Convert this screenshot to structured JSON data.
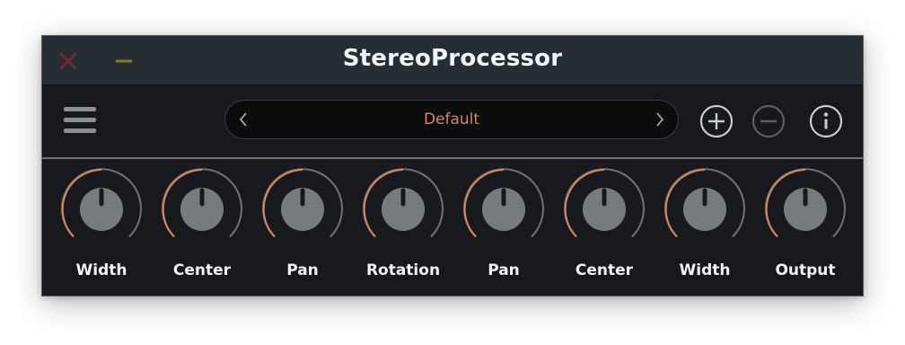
{
  "window": {
    "title": "StereoProcessor"
  },
  "toolbar": {
    "menu_icon": "hamburger-menu-icon",
    "preset": {
      "name": "Default",
      "prev_icon": "chevron-left-icon",
      "next_icon": "chevron-right-icon"
    },
    "add_icon": "plus-circle-icon",
    "remove_icon": "minus-circle-icon",
    "info_icon": "info-circle-icon"
  },
  "knobs": [
    {
      "label": "Width"
    },
    {
      "label": "Center"
    },
    {
      "label": "Pan"
    },
    {
      "label": "Rotation"
    },
    {
      "label": "Pan"
    },
    {
      "label": "Center"
    },
    {
      "label": "Width"
    },
    {
      "label": "Output"
    }
  ],
  "colors": {
    "accent": "#d9845b",
    "titlebar": "#262e33",
    "panel": "#17191c",
    "knob_body": "#777b80",
    "arc_track": "#6f7378",
    "close": "#7a2a2e",
    "minimize": "#8a7a28"
  }
}
